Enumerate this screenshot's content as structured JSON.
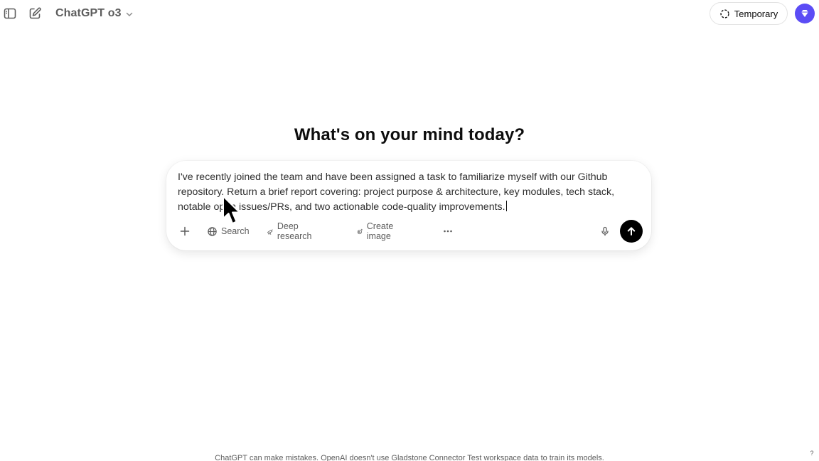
{
  "header": {
    "model_name": "ChatGPT o3",
    "temporary_label": "Temporary"
  },
  "main": {
    "headline": "What's on your mind today?"
  },
  "composer": {
    "text": "I've recently joined the team and have been assigned a task to familiarize myself with our Github repository. Return a brief report covering: project purpose & architecture, key modules, tech stack, notable open issues/PRs, and two actionable code-quality improvements.",
    "tools": {
      "search_label": "Search",
      "deep_research_label": "Deep research",
      "create_image_label": "Create image"
    }
  },
  "footer": {
    "disclaimer": "ChatGPT can make mistakes. OpenAI doesn't use Gladstone Connector Test workspace data to train its models.",
    "help_label": "?"
  },
  "colors": {
    "avatar_bg": "#5b4cf5",
    "send_bg": "#000000",
    "text_primary": "#0d0d0d",
    "text_secondary": "#5d5d5d"
  },
  "icons": {
    "sidebar_toggle": "sidebar-toggle-icon",
    "new_chat": "pencil-square-icon",
    "model_chevron": "chevron-down-icon",
    "temporary": "dashed-circle-icon",
    "avatar": "diamond-badge-icon",
    "plus": "plus-icon",
    "search": "globe-icon",
    "deep_research": "telescope-icon",
    "create_image": "image-sparkle-icon",
    "more": "ellipsis-icon",
    "mic": "microphone-icon",
    "send": "arrow-up-icon"
  }
}
